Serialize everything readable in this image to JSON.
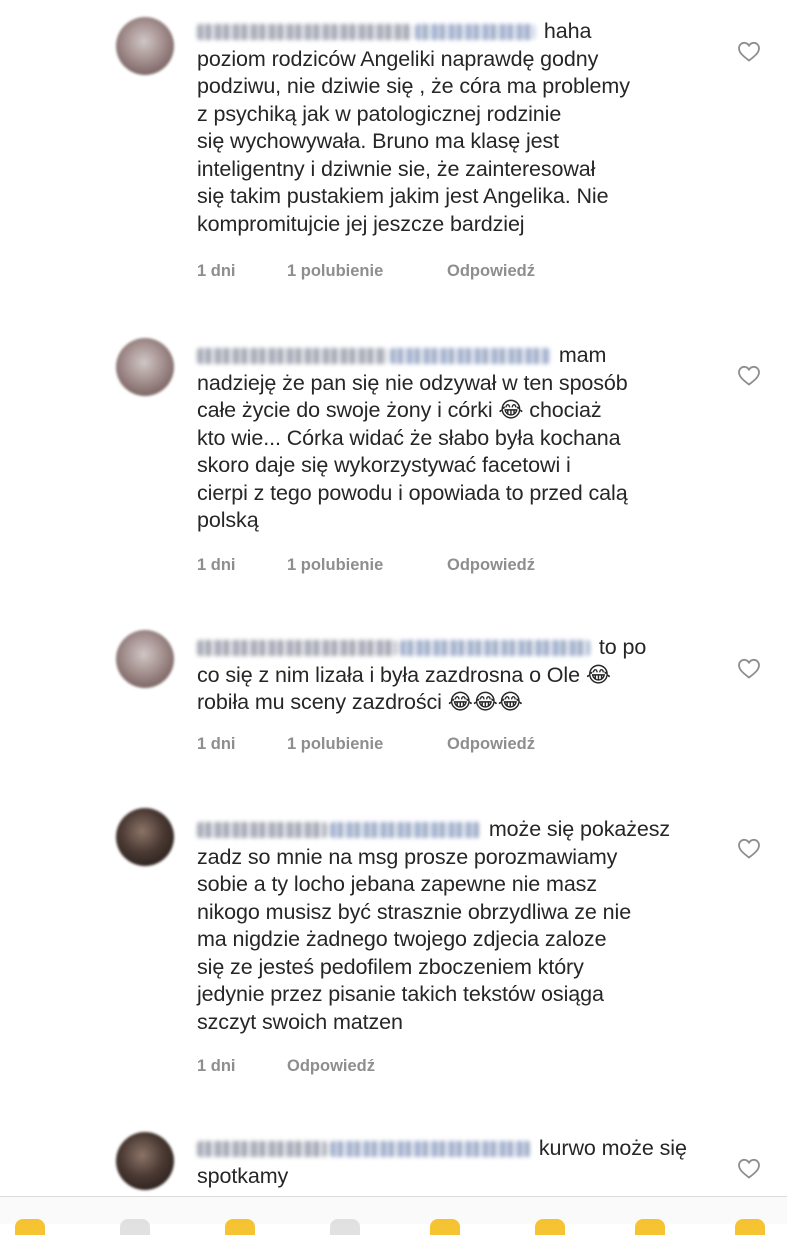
{
  "comments": [
    {
      "text_lines": [
        "haha",
        "poziom rodziców Angeliki naprawdę godny",
        "podziwu, nie dziwie się , że córa ma problemy",
        "z psychiką jak w patologicznej rodzinie",
        "się wychowywała. Bruno ma klasę jest",
        "inteligentny i dziwnie sie, że zainteresował",
        "się takim pustakiem jakim jest Angelika. Nie",
        "kompromitujcie jej jeszcze bardziej"
      ],
      "time": "1 dni",
      "likes": "1 polubienie",
      "reply": "Odpowiedź"
    },
    {
      "text_lines": [
        "mam",
        "nadzieję że pan się nie odzywał w ten sposób",
        "całe życie do swoje żony i córki 😂 chociaż",
        "kto wie... Córka widać że słabo była kochana",
        "skoro daje się wykorzystywać facetowi i",
        "cierpi z tego powodu i opowiada to przed calą",
        "polską"
      ],
      "time": "1 dni",
      "likes": "1 polubienie",
      "reply": "Odpowiedź"
    },
    {
      "text_lines": [
        "to po",
        "co się z nim lizała i była zazdrosna o Ole 😂",
        "robiła mu sceny zazdrości 😂😂😂"
      ],
      "time": "1 dni",
      "likes": "1 polubienie",
      "reply": "Odpowiedź"
    },
    {
      "text_lines": [
        "może się pokażesz",
        "zadz so mnie na msg prosze porozmawiamy",
        "sobie a ty  locho jebana zapewne nie masz",
        "nikogo musisz być strasznie obrzydliwa ze nie",
        "ma nigdzie żadnego twojego zdjecia zaloze",
        "się ze jesteś pedofilem zboczeniem który",
        "jedynie przez pisanie takich tekstów osiąga",
        "szczyt swoich matzen"
      ],
      "time": "1 dni",
      "reply": "Odpowiedź"
    },
    {
      "text_lines": [
        "kurwo może się",
        "spotkamy"
      ]
    }
  ],
  "icons": {
    "like": "heart-outline-icon",
    "avatar": "user-avatar"
  },
  "colors": {
    "text": "#262626",
    "meta": "#8e8e8e",
    "heart": "#8e8e8e"
  }
}
